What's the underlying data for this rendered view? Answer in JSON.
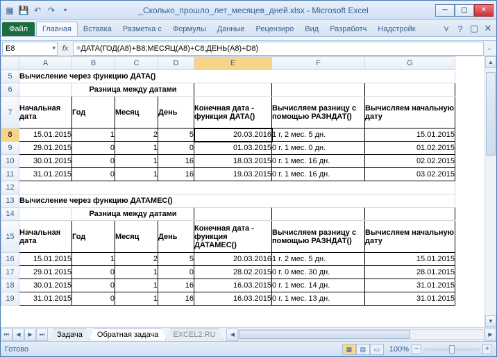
{
  "title": "_Сколько_прошло_лет_месяцев_дней.xlsx - Microsoft Excel",
  "ribbon": {
    "file": "Файл",
    "tabs": [
      "Главная",
      "Вставка",
      "Разметка с",
      "Формулы",
      "Данные",
      "Рецензиро",
      "Вид",
      "Разработч",
      "Надстройк"
    ]
  },
  "namebox": "E8",
  "formula": "=ДАТА(ГОД(A8)+B8;МЕСЯЦ(A8)+C8;ДЕНЬ(A8)+D8)",
  "cols": [
    "A",
    "B",
    "C",
    "D",
    "E",
    "F",
    "G"
  ],
  "rows_visible": [
    5,
    6,
    7,
    8,
    9,
    10,
    11,
    12,
    13,
    14,
    15,
    16,
    17,
    18,
    19
  ],
  "section1_title": "Вычисление через функцию ДАТА()",
  "diff_header": "Разница между датами",
  "hdr": {
    "start": "Начальная дата",
    "year": "Год",
    "month": "Месяц",
    "day": "День",
    "end1": "Конечная дата - функция ДАТА()",
    "diff": "Вычисляем разницу с помощью РАЗНДАТ()",
    "calc": "Вычисляем начальную дату",
    "end2": "Конечная дата - функция ДАТАМЕС()"
  },
  "t1": [
    {
      "a": "15.01.2015",
      "b": "1",
      "c": "2",
      "d": "5",
      "e": "20.03.2016",
      "f": "1 г. 2 мес. 5 дн.",
      "g": "15.01.2015"
    },
    {
      "a": "29.01.2015",
      "b": "0",
      "c": "1",
      "d": "0",
      "e": "01.03.2015",
      "f": "0 г. 1 мес. 0 дн.",
      "g": "01.02.2015"
    },
    {
      "a": "30.01.2015",
      "b": "0",
      "c": "1",
      "d": "16",
      "e": "18.03.2015",
      "f": "0 г. 1 мес. 16 дн.",
      "g": "02.02.2015"
    },
    {
      "a": "31.01.2015",
      "b": "0",
      "c": "1",
      "d": "16",
      "e": "19.03.2015",
      "f": "0 г. 1 мес. 16 дн.",
      "g": "03.02.2015"
    }
  ],
  "section2_title": "Вычисление через функцию ДАТАМЕС()",
  "t2": [
    {
      "a": "15.01.2015",
      "b": "1",
      "c": "2",
      "d": "5",
      "e": "20.03.2016",
      "f": "1 г. 2 мес. 5 дн.",
      "g": "15.01.2015"
    },
    {
      "a": "29.01.2015",
      "b": "0",
      "c": "1",
      "d": "0",
      "e": "28.02.2015",
      "f": "0 г. 0 мес. 30 дн.",
      "g": "28.01.2015"
    },
    {
      "a": "30.01.2015",
      "b": "0",
      "c": "1",
      "d": "16",
      "e": "16.03.2015",
      "f": "0 г. 1 мес. 14 дн.",
      "g": "31.01.2015"
    },
    {
      "a": "31.01.2015",
      "b": "0",
      "c": "1",
      "d": "16",
      "e": "16.03.2015",
      "f": "0 г. 1 мес. 13 дн.",
      "g": "31.01.2015"
    }
  ],
  "sheets": {
    "s1": "Задача",
    "s2": "Обратная задача",
    "s3": "EXCEL2.RU"
  },
  "status": "Готово",
  "zoom": "100%"
}
